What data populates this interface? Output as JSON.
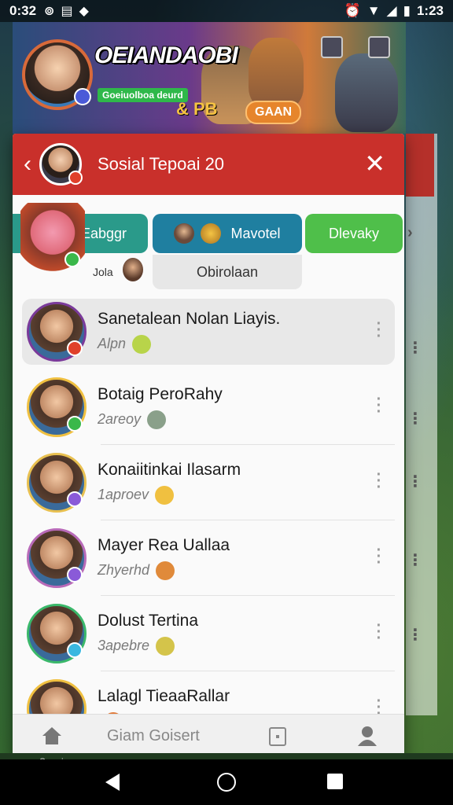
{
  "status_bar": {
    "time": "0:32",
    "right_time": "1:23",
    "icons": [
      "sync-icon",
      "news-icon",
      "shield-icon",
      "alarm-icon",
      "wifi-icon",
      "signal-icon",
      "battery-icon"
    ]
  },
  "game": {
    "title": "OEIANDAOBI",
    "subtag": "Goeiuolboa deurd",
    "xp_label": "& PB",
    "action_button": "GAAN"
  },
  "modal": {
    "title": "Sosial Tepoai 20",
    "tabs": [
      {
        "label": "Eabggr"
      },
      {
        "label": "Mavotel"
      },
      {
        "label": "Dlevaky"
      }
    ],
    "subtab_label": "Obirolaan",
    "under_tab_label": "Jola"
  },
  "friends": [
    {
      "name": "Sanetalean Nolan Liayis.",
      "status": "Alpn",
      "emoji": "#b8d44a",
      "badge": "#e0402a",
      "ring": "#7a3a9a",
      "selected": true
    },
    {
      "name": "Botaig PeroRahy",
      "status": "2areoy",
      "emoji": "#8aa08a",
      "badge": "#3ab84a",
      "ring": "#f0c040",
      "selected": false
    },
    {
      "name": "Konaiitinkai Ilasarm",
      "status": "1aproev",
      "emoji": "#f0c040",
      "badge": "#8a5ad8",
      "ring": "#e8c050",
      "selected": false
    },
    {
      "name": "Mayer Rea Uallaa",
      "status": "Zhyerhd",
      "emoji": "#e08a3a",
      "badge": "#8a5ad8",
      "ring": "#b86ab8",
      "selected": false
    },
    {
      "name": "Dolust Tertina",
      "status": "3apebre",
      "emoji": "#d4c44a",
      "badge": "#3ab8e0",
      "ring": "#3ab86a",
      "selected": false
    },
    {
      "name": "Lalagl TieaaRallar",
      "status": "",
      "emoji": "#e07a3a",
      "badge": "#3ab84a",
      "ring": "#f0c040",
      "selected": false
    }
  ],
  "bottom_nav": {
    "label": "Giam Goisert"
  },
  "bottom_game_label": "Saeeinns",
  "colors": {
    "header_red": "#c9302b",
    "tab_teal": "#2a9a8a",
    "tab_blue": "#1f7fa0",
    "tab_green": "#4fbf4a"
  }
}
